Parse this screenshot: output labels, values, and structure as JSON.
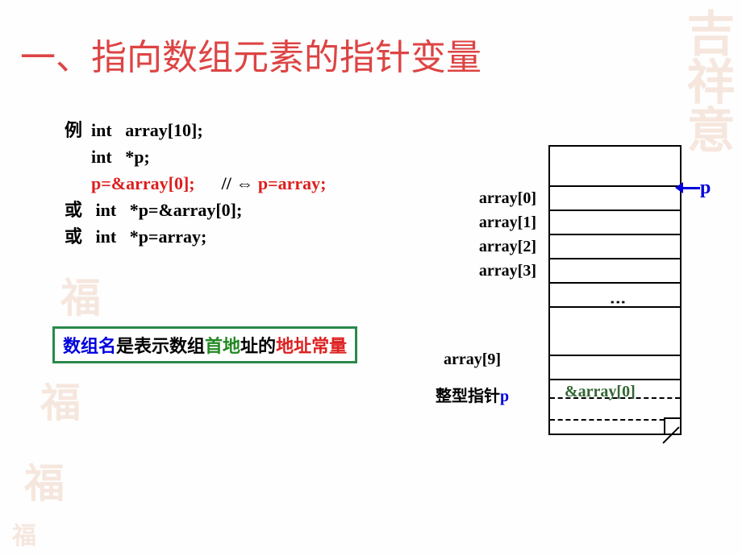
{
  "title": "一、指向数组元素的指针变量",
  "code": {
    "line1_label": "例  ",
    "line1_code": "int   array[10];",
    "line2_code": "int   *p;",
    "line3_code": "p=&array[0];",
    "line3_comment_slash": "// ",
    "line3_comment_code": " p=array;",
    "line4_label": "或   ",
    "line4_code": "int   *p=&array[0];",
    "line5_label": "或   ",
    "line5_code": "int   *p=array;"
  },
  "note": {
    "p1": "数组名",
    "p2": "是表示数组",
    "p3": "首地",
    "p4": "址的",
    "p5": "地址常量"
  },
  "diagram": {
    "labels": [
      "array[0]",
      "array[1]",
      "array[2]",
      "array[3]",
      "array[9]"
    ],
    "pointer_name": "p",
    "ptr_text_pre": "整型指针",
    "ptr_text_p": "p",
    "ptr_value": "&array[0]"
  },
  "watermarks": {
    "tr": "吉祥意",
    "seal": "福"
  }
}
